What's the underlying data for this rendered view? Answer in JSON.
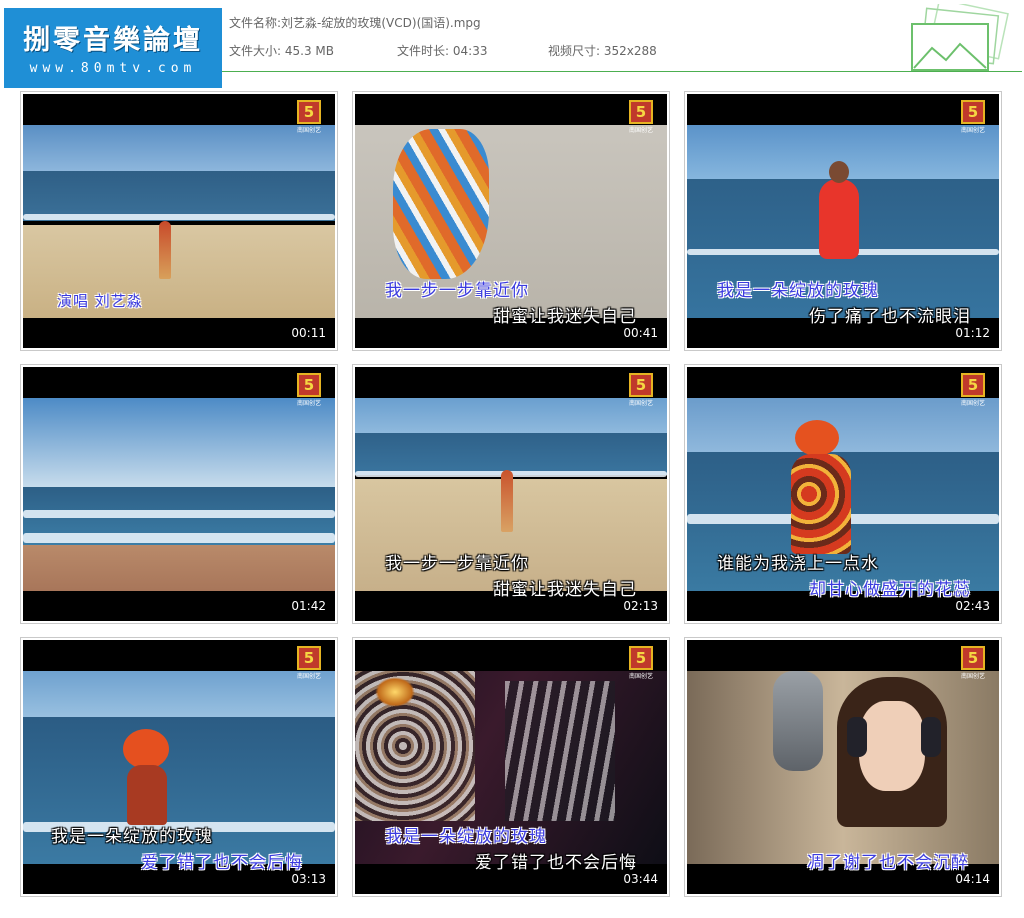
{
  "header": {
    "logo_title": "捌零音樂論壇",
    "logo_url": "www.80mtv.com",
    "file_name_label": "文件名称:",
    "file_name": "刘艺淼-绽放的玫瑰(VCD)(国语).mpg",
    "file_size_label": "文件大小:",
    "file_size": "45.3 MB",
    "duration_label": "文件时长:",
    "duration": "04:33",
    "video_size_label": "视频尺寸:",
    "video_size": "352x288"
  },
  "channel_logo": {
    "glyph": "5",
    "text": "南国创艺"
  },
  "thumbnails": [
    {
      "time": "00:11",
      "lyric1": "演唱  刘艺淼",
      "lyric2": ""
    },
    {
      "time": "00:41",
      "lyric1": "我一步一步靠近你",
      "lyric2": "甜蜜让我迷失自己"
    },
    {
      "time": "01:12",
      "lyric1": "我是一朵绽放的玫瑰",
      "lyric2": "伤了痛了也不流眼泪"
    },
    {
      "time": "01:42",
      "lyric1": "",
      "lyric2": ""
    },
    {
      "time": "02:13",
      "lyric1": "我一步一步靠近你",
      "lyric2": "甜蜜让我迷失自己"
    },
    {
      "time": "02:43",
      "lyric1": "谁能为我浇上一点水",
      "lyric2": "却甘心做盛开的花蕊"
    },
    {
      "time": "03:13",
      "lyric1": "我是一朵绽放的玫瑰",
      "lyric2": "爱了错了也不会后悔"
    },
    {
      "time": "03:44",
      "lyric1": "我是一朵绽放的玫瑰",
      "lyric2": "爱了错了也不会后悔"
    },
    {
      "time": "04:14",
      "lyric1": "",
      "lyric2": "凋了谢了也不会沉醉"
    }
  ],
  "colors": {
    "logo_bg": "#1f8fd6",
    "divider": "#4caf50",
    "lyric_blue": "#3b3bdf"
  }
}
